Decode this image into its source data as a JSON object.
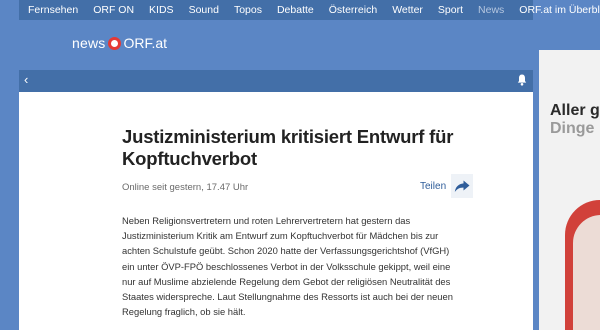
{
  "topnav": {
    "items": [
      "Fernsehen",
      "ORF ON",
      "KIDS",
      "Sound",
      "Topos",
      "Debatte",
      "Österreich",
      "Wetter",
      "Sport",
      "News",
      "ORF.at im Überblick"
    ]
  },
  "logo": {
    "news": "news",
    "orf": "ORF.at"
  },
  "subbar": {
    "back_icon": "chevron-left-icon",
    "bell_icon": "bell-icon"
  },
  "article": {
    "title": "Justizministerium kritisiert Entwurf für Kopftuchverbot",
    "meta": "Online seit gestern, 17.47 Uhr",
    "share_label": "Teilen",
    "share_icon": "share-arrow-icon",
    "body": "Neben Religionsvertretern und roten Lehrervertretern hat gestern das Justizministerium Kritik am Entwurf zum Kopftuchverbot für Mädchen bis zur achten Schulstufe geübt. Schon 2020 hatte der Verfassungsgerichtshof (VfGH) ein unter ÖVP-FPÖ beschlossenes Verbot in der Volksschule gekippt, weil eine nur auf Muslime abzielende Regelung dem Gebot der religiösen Neutralität des Staates widerspreche. Laut Stellungnahme des Ressorts ist auch bei der neuen Regelung fraglich, ob sie hält."
  },
  "ad": {
    "line1": "Aller g",
    "line2": "Dinge"
  },
  "colors": {
    "page_bg": "#5b86c5",
    "nav_bg": "#436fa8",
    "logo_red": "#e53935",
    "link_blue": "#2f5d9a"
  }
}
